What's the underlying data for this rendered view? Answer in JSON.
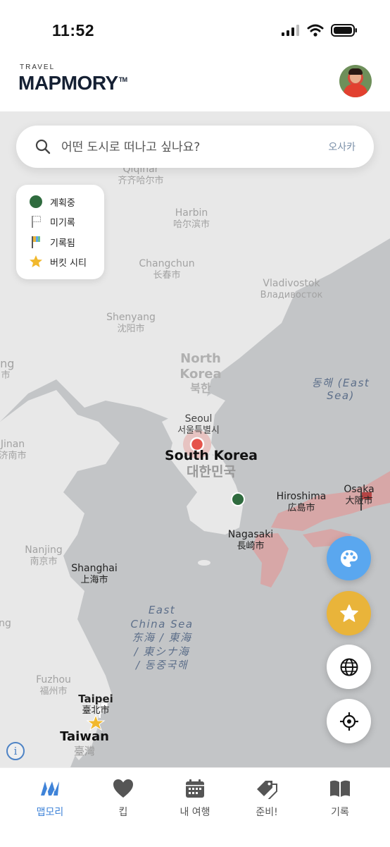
{
  "status_bar": {
    "time": "11:52"
  },
  "header": {
    "brand_small": "TRAVEL",
    "brand_name": "MAPMORY",
    "brand_tm": "TM"
  },
  "search": {
    "placeholder": "어떤 도시로 떠나고 싶나요?",
    "current_city": "오사카"
  },
  "legend": [
    {
      "label": "계획중",
      "icon": "green-dot-icon"
    },
    {
      "label": "미기록",
      "icon": "white-flag-icon"
    },
    {
      "label": "기록됨",
      "icon": "color-flag-icon"
    },
    {
      "label": "버킷 시티",
      "icon": "star-icon"
    }
  ],
  "map": {
    "labels": {
      "qiqihar": "Qiqihar",
      "qiqihar_local": "齐齐哈尔市",
      "harbin": "Harbin",
      "harbin_local": "哈尔滨市",
      "changchun": "Changchun",
      "changchun_local": "长春市",
      "vladivostok": "Vladivostok",
      "vladivostok_local": "Владивосток",
      "shenyang": "Shenyang",
      "shenyang_local": "沈阳市",
      "beijing_partial": "ing",
      "beijing_partial_local": "市",
      "north_korea": "North",
      "north_korea_2": "Korea",
      "north_korea_local": "북한",
      "seoul": "Seoul",
      "seoul_local": "서울특별시",
      "south_korea": "South Korea",
      "south_korea_local": "대한민국",
      "east_sea": "동해 (East",
      "east_sea_2": "Sea)",
      "jinan": "Jinan",
      "jinan_local": "济南市",
      "hiroshima": "Hiroshima",
      "hiroshima_local": "広島市",
      "osaka": "Osaka",
      "osaka_local": "大阪市",
      "nagasaki": "Nagasaki",
      "nagasaki_local": "長崎市",
      "nanjing": "Nanjing",
      "nanjing_local": "南京市",
      "shanghai": "Shanghai",
      "shanghai_local": "上海市",
      "east_china_sea": "East",
      "east_china_sea_2": "China Sea",
      "east_china_sea_3": "东海 / 東海",
      "east_china_sea_4": "/ 東シナ海",
      "east_china_sea_5": "/ 동중국해",
      "ng_partial": "ng",
      "fuzhou": "Fuzhou",
      "fuzhou_local": "福州市",
      "taipei": "Taipei",
      "taipei_local": "臺北市",
      "taiwan": "Taiwan",
      "taiwan_local": "臺灣"
    },
    "info_symbol": "i"
  },
  "fabs": [
    {
      "name": "palette-button",
      "icon": "palette-icon",
      "color": "#5aa7ef"
    },
    {
      "name": "bucket-star-button",
      "icon": "star-icon",
      "color": "#e9b43a"
    },
    {
      "name": "globe-button",
      "icon": "globe-icon",
      "color": "#ffffff"
    },
    {
      "name": "my-location-button",
      "icon": "crosshair-icon",
      "color": "#ffffff"
    }
  ],
  "tabs": [
    {
      "label": "맵모리",
      "icon": "mapmory-icon",
      "active": true
    },
    {
      "label": "킵",
      "icon": "heart-icon",
      "active": false
    },
    {
      "label": "내 여행",
      "icon": "calendar-icon",
      "active": false
    },
    {
      "label": "준비!",
      "icon": "tag-icon",
      "active": false
    },
    {
      "label": "기록",
      "icon": "book-icon",
      "active": false
    }
  ],
  "colors": {
    "accent": "#3f83d8",
    "planned": "#2f6b3e",
    "visited_region": "#d9a3a3",
    "current_location": "#e5534b"
  }
}
